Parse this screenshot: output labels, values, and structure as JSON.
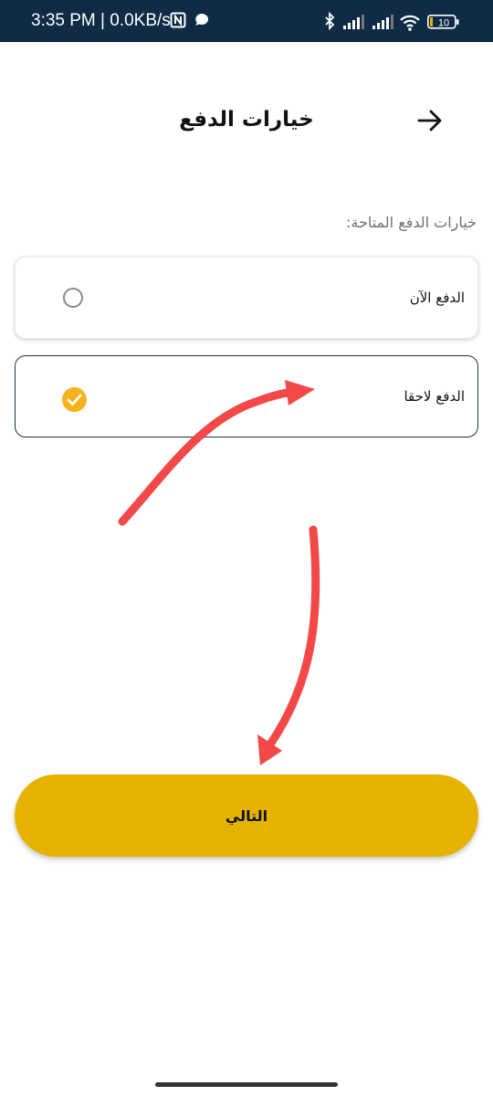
{
  "status_bar": {
    "time": "3:35 PM | 0.0KB/s",
    "battery": "10",
    "icons": [
      "nfc-icon",
      "chat-bubble-icon",
      "bluetooth-icon",
      "signal-icon",
      "signal-icon",
      "wifi-icon",
      "battery-icon"
    ]
  },
  "header": {
    "title": "خيارات الدفع",
    "back_icon": "arrow-right-icon"
  },
  "payment": {
    "section_label": "خيارات الدفع المتاحة:",
    "options": [
      {
        "label": "الدفع الآن",
        "selected": false
      },
      {
        "label": "الدفع لاحقا",
        "selected": true
      }
    ]
  },
  "next_button": {
    "label": "التالي"
  },
  "colors": {
    "status_bar": "#0f2b45",
    "accent": "#e6b200",
    "check": "#f4b31c",
    "selected_border": "#1c3346",
    "annotation_arrow": "#f24848"
  }
}
